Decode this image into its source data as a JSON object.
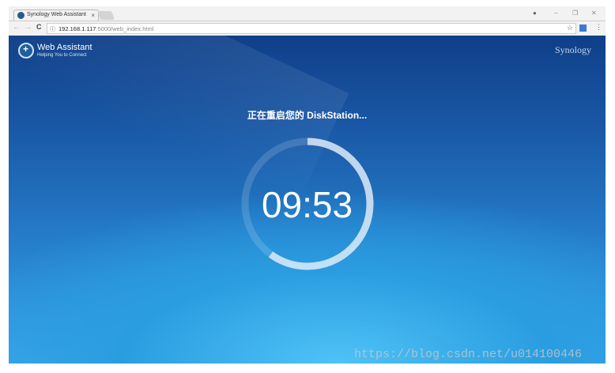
{
  "browser": {
    "tab_title": "Synology Web Assistant",
    "tab_close": "×",
    "url_host": "192.168.1.117",
    "url_rest": ":5000/web_index.html",
    "back": "←",
    "forward": "→",
    "reload": "C",
    "info_icon": "ⓘ",
    "star": "☆",
    "menu": "⋮",
    "minimize": "–",
    "maximize": "❐",
    "close": "✕"
  },
  "header": {
    "app_name": "Web Assistant",
    "tagline": "Helping You to Connect",
    "brand": "Synology"
  },
  "main": {
    "message": "正在重启您的 DiskStation...",
    "countdown": "09:53",
    "progress": 0.6
  },
  "watermark": "https://blog.csdn.net/u014100446"
}
